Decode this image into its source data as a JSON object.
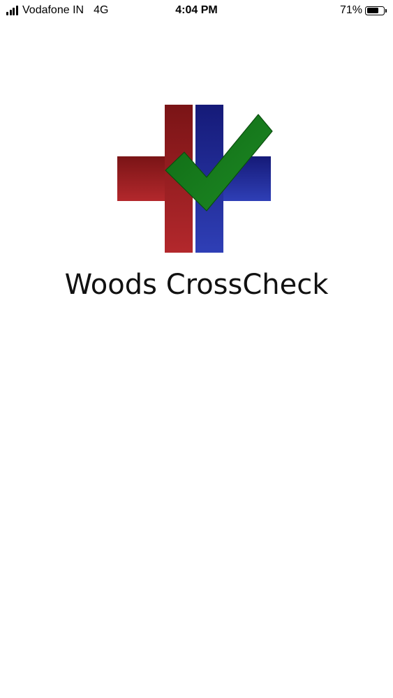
{
  "status_bar": {
    "carrier": "Vodafone IN",
    "network": "4G",
    "time": "4:04 PM",
    "battery_percent_label": "71%",
    "battery_level": 0.71,
    "signal_bars": 4
  },
  "splash": {
    "app_name": "Woods CrossCheck",
    "logo_icon": "cross-check-logo-icon",
    "colors": {
      "red": "#a8262a",
      "blue": "#2633a3",
      "green": "#147a1a"
    }
  }
}
